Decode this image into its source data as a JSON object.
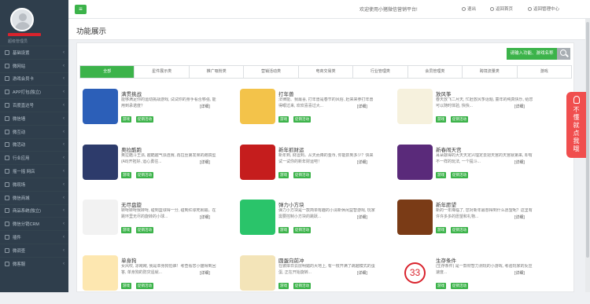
{
  "sidebar": {
    "user_meta": "超级管理员",
    "items": [
      {
        "label": "基础设置"
      },
      {
        "label": "微网站"
      },
      {
        "label": "游戏会员卡"
      },
      {
        "label": "APP打包(独立)"
      },
      {
        "label": "百度直达号"
      },
      {
        "label": "微信墙"
      },
      {
        "label": "微互动"
      },
      {
        "label": "微活动"
      },
      {
        "label": "行业应用"
      },
      {
        "label": "摇一摇 网店"
      },
      {
        "label": "微现场"
      },
      {
        "label": "微信商城"
      },
      {
        "label": "商品系统(独立)"
      },
      {
        "label": "微信分销CRM"
      },
      {
        "label": "插件"
      },
      {
        "label": "微调查"
      },
      {
        "label": "微客服"
      }
    ]
  },
  "topbar": {
    "menu_icon": "≡",
    "welcome": "欢迎使用小猪微信营销平台!",
    "links": [
      "退出",
      "返回首页",
      "返回管理中心"
    ]
  },
  "title": "功能展示",
  "search": {
    "button_label": "请输入功能、游戏名称"
  },
  "tabs": [
    "全部",
    "星件展示类",
    "推广吸粉类",
    "营销活动类",
    "电商交易类",
    "行业管理类",
    "会员管理类",
    "跨境流量类",
    "游戏"
  ],
  "cards": [
    {
      "title": "满贯挑战",
      "desc": "能够满足你的运动挑战游戏, 试试你的身手看否够强, 能用到承诺度？",
      "tags": [
        "游戏",
        "促销活动"
      ],
      "detail": "[详细]",
      "color": "#2c5fb8"
    },
    {
      "title": "打年兽",
      "desc": "法律能、我最喜, 打年兽是春节的风俗, 赶来来参打年兽得眼过来, 欢欢喜喜过大...",
      "tags": [
        "游戏",
        "促销活动"
      ],
      "detail": "[详细]",
      "color": "#f3c34a"
    },
    {
      "title": "放风筝",
      "desc": "春天放飞二月天, 忙赶放风筝话题, 童年的纯真快乐, 给您可以随时体验, 快快...",
      "tags": [
        "游戏",
        "促销活动"
      ],
      "detail": "[详细]",
      "color": "#f6f1dd"
    },
    {
      "title": "奥拉酷跑",
      "desc": "奥拉酷斗王派, 越酷越气派连赛, 再拉丝第发果的跑搞型(A8)开拓好, 运心勇往...",
      "tags": [
        "游戏",
        "促销活动"
      ],
      "detail": "[详细]",
      "color": "#2d3b6b"
    },
    {
      "title": "新年抓财运",
      "desc": "新年到, 财运到。从天而降的金币, 你能抓到多少？快来试一试你的新年财运吧！",
      "tags": [
        "游戏",
        "促销活动"
      ],
      "detail": "[详细]",
      "color": "#c51d1d"
    },
    {
      "title": "新春闹天宫",
      "desc": "耳朵敲得的大天天定兴理定去把天宫的天宫就第来, 却有不一样的玩法, 一个提斗...",
      "tags": [
        "游戏",
        "促销活动"
      ],
      "detail": "[详细]",
      "color": "#5a2a7a"
    },
    {
      "title": "无尽盘旋",
      "desc": "转呀转呀我转呀, 碰到篮球得一分, 碰到红球死就输。在跳环里无尽的旋转的小球...",
      "tags": [
        "游戏",
        "促销活动"
      ],
      "detail": "[详细]",
      "color": "#f2f2f2"
    },
    {
      "title": "弹力小方块",
      "desc": "弹力小方块是一款简单有趣的小清新休闲益智游戏, 玩家需要控制小方块的跳跃...",
      "tags": [
        "游戏",
        "促销活动"
      ],
      "detail": "[详细]",
      "color": "#2ac46a"
    },
    {
      "title": "新年愿望",
      "desc": "新的一年降临了, 您对新年最想得到什么愿望呢？这里有许许多多的愿望和礼物...",
      "tags": [
        "游戏",
        "促销活动"
      ],
      "detail": "[详细]",
      "color": "#7a3b16"
    },
    {
      "title": "单身狗",
      "desc": "女风吹, 凉飕飕, 我是单身狗怕谁！考查看您小猫得到回答, 单身狗的防灾遥就...",
      "tags": [
        "游戏",
        "促销活动"
      ],
      "detail": "[详细]",
      "color": "#fde7b0"
    },
    {
      "title": "圆蛋向前冲",
      "desc": "在彼岸日云层明媚的大地上, 有一枝开满了跳越模式的蛋蛋, 正在开始旋转...",
      "tags": [
        "游戏",
        "促销活动"
      ],
      "detail": "[详细]",
      "color": "#f3e4b8"
    },
    {
      "title": "生存条件",
      "desc": "(生存条件) 是一款材智力测玩的小游戏, 考验玩家的反应速度...",
      "tags": [
        "游戏",
        "促销活动"
      ],
      "detail": "[详细]",
      "color": "#ffffff",
      "badge": "33"
    }
  ],
  "float_widget": {
    "text": "不懂就点我哦"
  }
}
